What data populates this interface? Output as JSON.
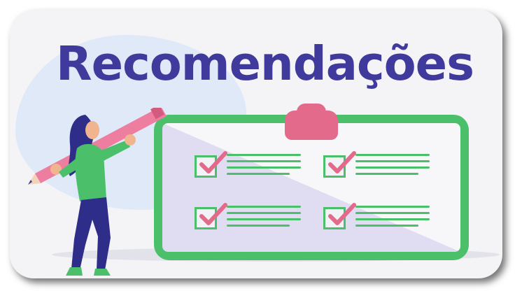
{
  "title": "Recomendações",
  "colors": {
    "title": "#3f3a9c",
    "board": "#4bbf6a",
    "check_mark": "#e46a8c",
    "clip": "#e46a8c",
    "pencil": "#ee7ea0",
    "shirt": "#4bbf6a",
    "pants": "#2e2d8a"
  },
  "icons": [
    "clipboard-icon",
    "checkbox-checked-icon",
    "person-with-pencil-illustration"
  ],
  "checklist": {
    "items": [
      {
        "checked": true
      },
      {
        "checked": true
      },
      {
        "checked": true
      },
      {
        "checked": true
      }
    ]
  }
}
